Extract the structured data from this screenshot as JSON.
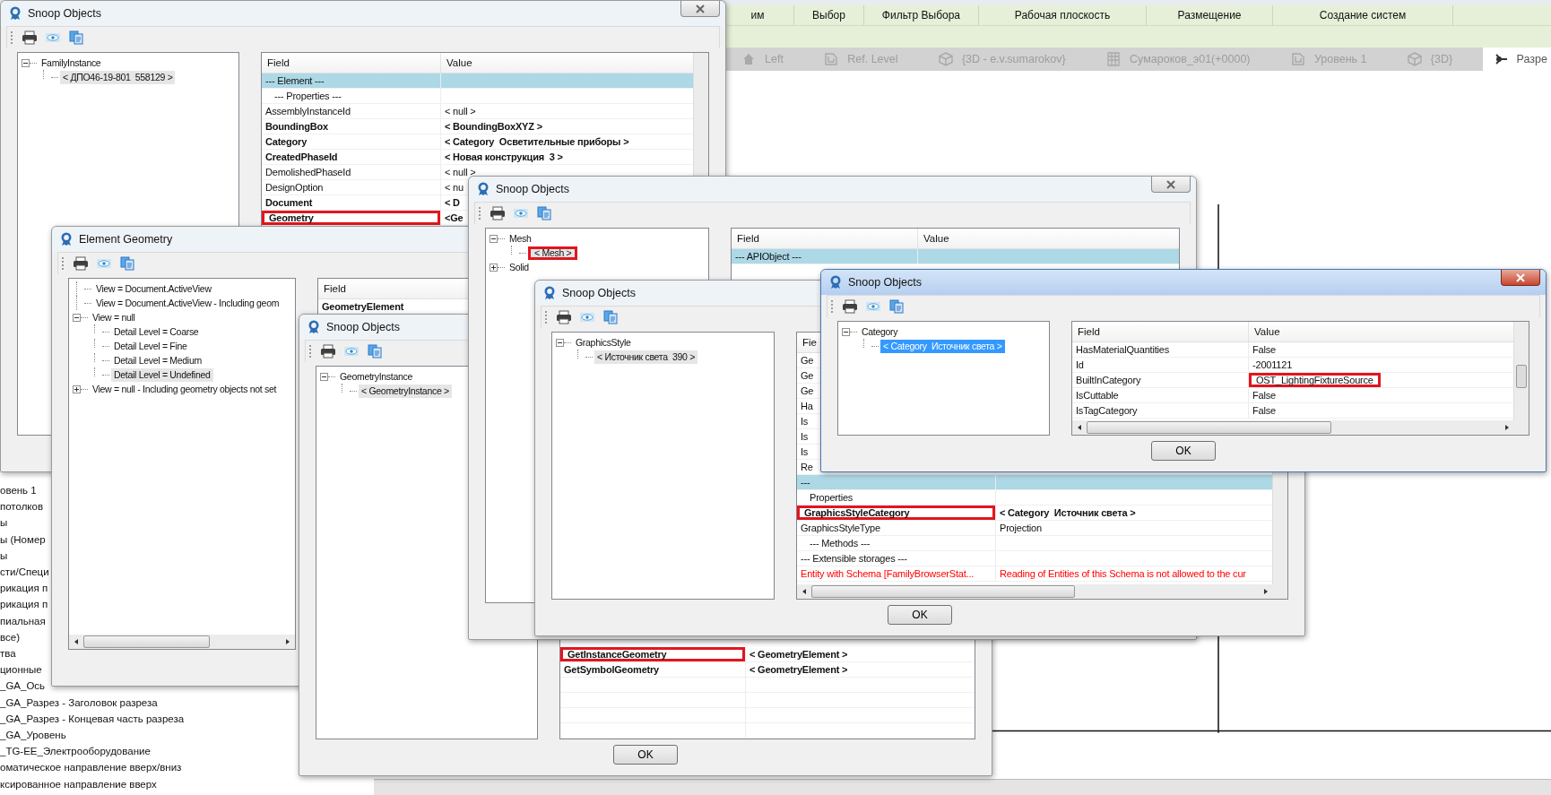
{
  "ribbon": {
    "panels": [
      "им",
      "Выбор",
      "Фильтр Выбора",
      "Рабочая плоскость",
      "Размещение",
      "Создание систем"
    ]
  },
  "view_tabs": [
    {
      "label": "Left",
      "kind": "elevation",
      "selected": false
    },
    {
      "label": "Ref. Level",
      "kind": "plan",
      "selected": false
    },
    {
      "label": "{3D - e.v.sumarokov}",
      "kind": "perspective",
      "selected": false
    },
    {
      "label": "Сумароков_э01(+0000)",
      "kind": "schedule",
      "selected": false
    },
    {
      "label": "Уровень 1",
      "kind": "plan",
      "selected": false
    },
    {
      "label": "{3D}",
      "kind": "perspective",
      "selected": false
    },
    {
      "label": "Разре",
      "kind": "section",
      "selected": true
    }
  ],
  "project_browser": {
    "items": [
      "овень 1",
      "потолков",
      "ы",
      "ы (Номер",
      "ы",
      "сти/Специ",
      "рикация п",
      "рикация п",
      "пиальная",
      "все)",
      "тва",
      "ционные",
      "_GA_Ось",
      "_GA_Разрез - Заголовок разреза",
      "_GA_Разрез - Концевая часть разреза",
      "_GA_Уровень",
      "_TG-EE_Электрооборудование",
      "оматическое направление вверх/вниз",
      "ксированное направление вверх"
    ]
  },
  "windows": [
    {
      "title": "Snoop Objects",
      "active": false,
      "close_button": true,
      "tree": [
        {
          "label": "FamilyInstance",
          "expanded": true,
          "selected": false,
          "children": [
            {
              "label": "< ДПО46-19-801  558129 >",
              "selected": true
            }
          ]
        }
      ],
      "table": {
        "columns": [
          "Field",
          "Value"
        ],
        "rows": [
          {
            "field": "--- Element ---",
            "kind": "section",
            "selected": true
          },
          {
            "field": "--- Properties ---",
            "kind": "subsection",
            "selected": false
          },
          {
            "field": "AssemblyInstanceId",
            "value": "< null >",
            "kind": "plain",
            "selected": false
          },
          {
            "field": "BoundingBox",
            "value": "< BoundingBoxXYZ >",
            "kind": "bold",
            "selected": false
          },
          {
            "field": "Category",
            "value": "< Category  Осветительные приборы >",
            "kind": "bold",
            "selected": false
          },
          {
            "field": "CreatedPhaseId",
            "value": "< Новая конструкция  3 >",
            "kind": "bold",
            "selected": false
          },
          {
            "field": "DemolishedPhaseId",
            "value": "< null >",
            "kind": "plain",
            "selected": false
          },
          {
            "field": "DesignOption",
            "value": "< nu",
            "kind": "plain",
            "selected": false
          },
          {
            "field": "Document",
            "value": "< D",
            "kind": "bold",
            "selected": false
          },
          {
            "field": "Geometry",
            "value": "<Ge",
            "kind": "bold",
            "selected": false,
            "field_marked": true
          }
        ]
      }
    },
    {
      "title": "Element Geometry",
      "active": false,
      "tree": [
        {
          "label": "View = Document.ActiveView",
          "selected": false
        },
        {
          "label": "View = Document.ActiveView - Including geom",
          "selected": false
        },
        {
          "label": "View = null",
          "expanded": true,
          "selected": false,
          "children": [
            {
              "label": "Detail Level = Coarse",
              "selected": false
            },
            {
              "label": "Detail Level = Fine",
              "selected": false
            },
            {
              "label": "Detail Level = Medium",
              "selected": false
            },
            {
              "label": "Detail Level = Undefined",
              "selected": true
            }
          ]
        },
        {
          "label": "View = null - Including geometry objects not set",
          "expanded": false,
          "selected": false
        }
      ],
      "table": {
        "columns": [
          "Field"
        ],
        "rows": [
          {
            "field": "GeometryElement",
            "kind": "bold",
            "selected": false
          }
        ]
      }
    },
    {
      "title": "Snoop Objects",
      "active": false,
      "tree": [
        {
          "label": "GeometryInstance",
          "expanded": true,
          "selected": false,
          "children": [
            {
              "label": "< GeometryInstance >",
              "selected": true
            }
          ]
        }
      ],
      "table": {
        "rows": [
          {
            "field": "GetInstanceGeometry",
            "value": "< GeometryElement >",
            "kind": "bold",
            "selected": false,
            "field_marked": true
          },
          {
            "field": "GetSymbolGeometry",
            "value": "< GeometryElement >",
            "kind": "bold",
            "selected": false
          }
        ]
      },
      "ok_button": "OK"
    },
    {
      "title": "Snoop Objects",
      "active": false,
      "close_button": true,
      "tree": [
        {
          "label": "Mesh",
          "expanded": true,
          "selected": false,
          "children": [
            {
              "label": "< Mesh >",
              "selected": true,
              "marked": true
            }
          ]
        },
        {
          "label": "Solid",
          "expanded": false,
          "selected": false
        }
      ],
      "table": {
        "columns": [
          "Field",
          "Value"
        ],
        "rows": [
          {
            "field": "--- APIObject ---",
            "kind": "section",
            "selected": true
          }
        ]
      }
    },
    {
      "title": "Snoop Objects",
      "active": false,
      "tree": [
        {
          "label": "GraphicsStyle",
          "expanded": true,
          "selected": false,
          "children": [
            {
              "label": "< Источник света  390 >",
              "selected": true
            }
          ]
        }
      ],
      "table": {
        "columns": [
          "Fie"
        ],
        "rows": [
          {
            "field": "Ge",
            "kind": "plain",
            "selected": false
          },
          {
            "field": "Ge",
            "kind": "plain",
            "selected": false
          },
          {
            "field": "Ge",
            "kind": "plain",
            "selected": false
          },
          {
            "field": "Ha",
            "kind": "plain",
            "selected": false
          },
          {
            "field": "Is",
            "kind": "plain",
            "selected": false
          },
          {
            "field": "Is",
            "kind": "plain",
            "selected": false
          },
          {
            "field": "Is",
            "kind": "plain",
            "selected": false
          },
          {
            "field": "Re",
            "kind": "plain",
            "selected": false
          },
          {
            "field": "---",
            "kind": "section",
            "selected": true
          },
          {
            "field": "Properties",
            "kind": "subsection",
            "selected": false
          },
          {
            "field": "GraphicsStyleCategory",
            "value": "< Category  Источник света >",
            "kind": "bold",
            "selected": false,
            "field_marked": true
          },
          {
            "field": "GraphicsStyleType",
            "value": "Projection",
            "kind": "plain",
            "selected": false
          },
          {
            "field": "--- Methods ---",
            "kind": "subsection",
            "selected": false
          },
          {
            "field": "--- Extensible storages ---",
            "kind": "section",
            "selected": false
          },
          {
            "field": "Entity with Schema [FamilyBrowserStat...",
            "value": "Reading of Entities of this Schema is not allowed to the cur",
            "kind": "error",
            "selected": false
          }
        ]
      },
      "ok_button": "OK"
    },
    {
      "title": "Snoop Objects",
      "active": true,
      "close_button": true,
      "tree": [
        {
          "label": "Category",
          "expanded": true,
          "selected": false,
          "children": [
            {
              "label": "< Category  Источник света >",
              "selected": true
            }
          ]
        }
      ],
      "table": {
        "columns": [
          "Field",
          "Value"
        ],
        "rows": [
          {
            "field": "HasMaterialQuantities",
            "value": "False",
            "kind": "plain",
            "selected": false
          },
          {
            "field": "Id",
            "value": "-2001121",
            "kind": "plain",
            "selected": false
          },
          {
            "field": "BuiltInCategory",
            "value": "OST_LightingFixtureSource",
            "kind": "plain",
            "selected": false,
            "value_marked": true
          },
          {
            "field": "IsCuttable",
            "value": "False",
            "kind": "plain",
            "selected": false
          },
          {
            "field": "IsTagCategory",
            "value": "False",
            "kind": "plain",
            "selected": false
          }
        ]
      },
      "ok_button": "OK"
    }
  ]
}
